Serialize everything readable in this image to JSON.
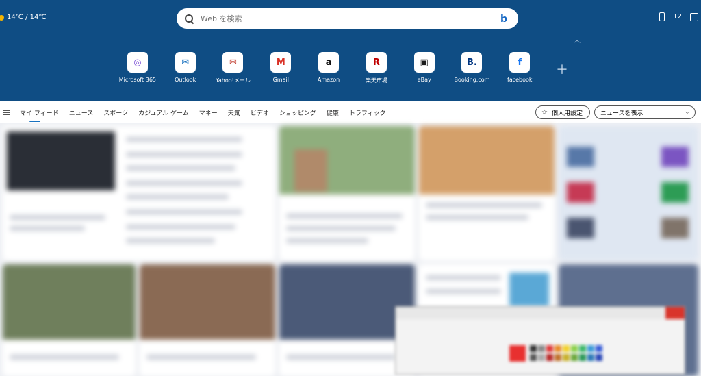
{
  "weather": {
    "temps": "14℃ / 14℃"
  },
  "top_right": {
    "count": "12"
  },
  "search": {
    "placeholder": "Web を検索",
    "bing": "b"
  },
  "quicklinks": [
    {
      "label": "Microsoft 365",
      "icon": "microsoft365-icon",
      "glyph": "◎",
      "color": "#7b4fd6"
    },
    {
      "label": "Outlook",
      "icon": "outlook-icon",
      "glyph": "✉",
      "color": "#0f6cbd"
    },
    {
      "label": "Yahoo!メール",
      "icon": "yahoo-mail-icon",
      "glyph": "✉",
      "color": "#c0392b"
    },
    {
      "label": "Gmail",
      "icon": "gmail-icon",
      "glyph": "M",
      "color": "#d93025"
    },
    {
      "label": "Amazon",
      "icon": "amazon-icon",
      "glyph": "a",
      "color": "#111111"
    },
    {
      "label": "楽天市場",
      "icon": "rakuten-icon",
      "glyph": "R",
      "color": "#bf0000"
    },
    {
      "label": "eBay",
      "icon": "ebay-icon",
      "glyph": "▣",
      "color": "#1a1a1a"
    },
    {
      "label": "Booking.com",
      "icon": "booking-icon",
      "glyph": "B.",
      "color": "#003580"
    },
    {
      "label": "facebook",
      "icon": "facebook-icon",
      "glyph": "f",
      "color": "#1877f2"
    }
  ],
  "nav": {
    "tabs": [
      "マイ フィード",
      "ニュース",
      "スポーツ",
      "カジュアル ゲーム",
      "マネー",
      "天気",
      "ビデオ",
      "ショッピング",
      "健康",
      "トラフィック"
    ],
    "active_index": 0,
    "personalize_label": "個人用設定",
    "news_select_label": "ニュースを表示"
  },
  "colors": {
    "header": "#0f4d84",
    "accent": "#0f6cbd"
  }
}
